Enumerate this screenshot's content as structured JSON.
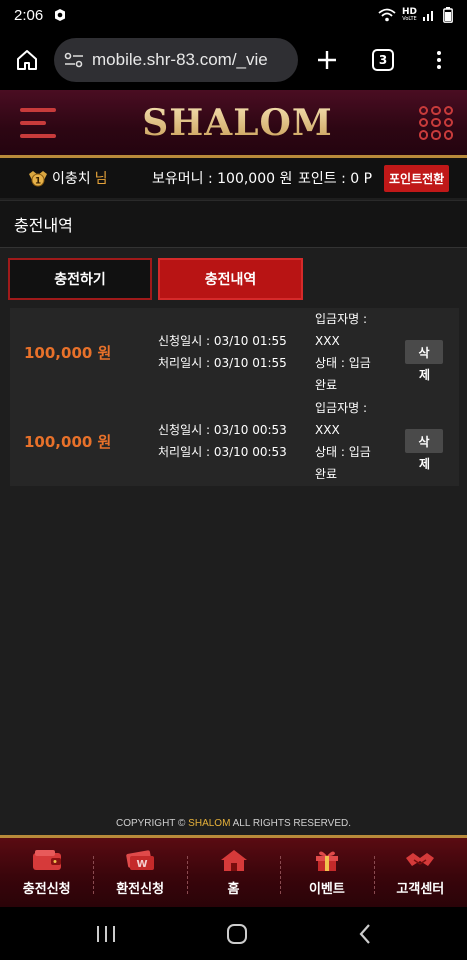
{
  "status_bar": {
    "time": "2:06",
    "network": "HD",
    "network_sub": "VoLTE"
  },
  "browser": {
    "url": "mobile.shr-83.com/_vie",
    "tab_count": "3"
  },
  "site": {
    "logo": "SHALOM"
  },
  "user_bar": {
    "level": "1",
    "name": "이충치",
    "suffix": "님",
    "money": "보유머니 : 100,000 원",
    "points": "포인트 : 0 P",
    "point_button": "포인트전환"
  },
  "section": {
    "title": "충전내역"
  },
  "tabs": {
    "charge": "충전하기",
    "history": "충전내역"
  },
  "records": [
    {
      "amount": "100,000 원",
      "request": "신청일시 : 03/10 01:55",
      "processed": "처리일시 : 03/10 01:55",
      "depositor": "입금자명 :",
      "depositor_value": "XXX",
      "status": "상태 : 입금",
      "status_value": "완료",
      "delete_a": "삭",
      "delete_b": "제"
    },
    {
      "amount": "100,000 원",
      "request": "신청일시 : 03/10 00:53",
      "processed": "처리일시 : 03/10 00:53",
      "depositor": "입금자명 :",
      "depositor_value": "XXX",
      "status": "상태 : 입금",
      "status_value": "완료",
      "delete_a": "삭",
      "delete_b": "제"
    }
  ],
  "footer": {
    "prefix": "COPYRIGHT © ",
    "brand": "SHALOM",
    "suffix": " ALL RIGHTS RESERVED."
  },
  "bottom_nav": [
    {
      "label": "충전신청",
      "icon": "wallet-icon"
    },
    {
      "label": "환전신청",
      "icon": "money-icon"
    },
    {
      "label": "홈",
      "icon": "home-icon"
    },
    {
      "label": "이벤트",
      "icon": "gift-icon"
    },
    {
      "label": "고객센터",
      "icon": "handshake-icon"
    }
  ],
  "colors": {
    "accent_red": "#b81414",
    "gold": "#b88a3a",
    "amount_orange": "#e8712a",
    "header_bg": "#2d0613"
  }
}
